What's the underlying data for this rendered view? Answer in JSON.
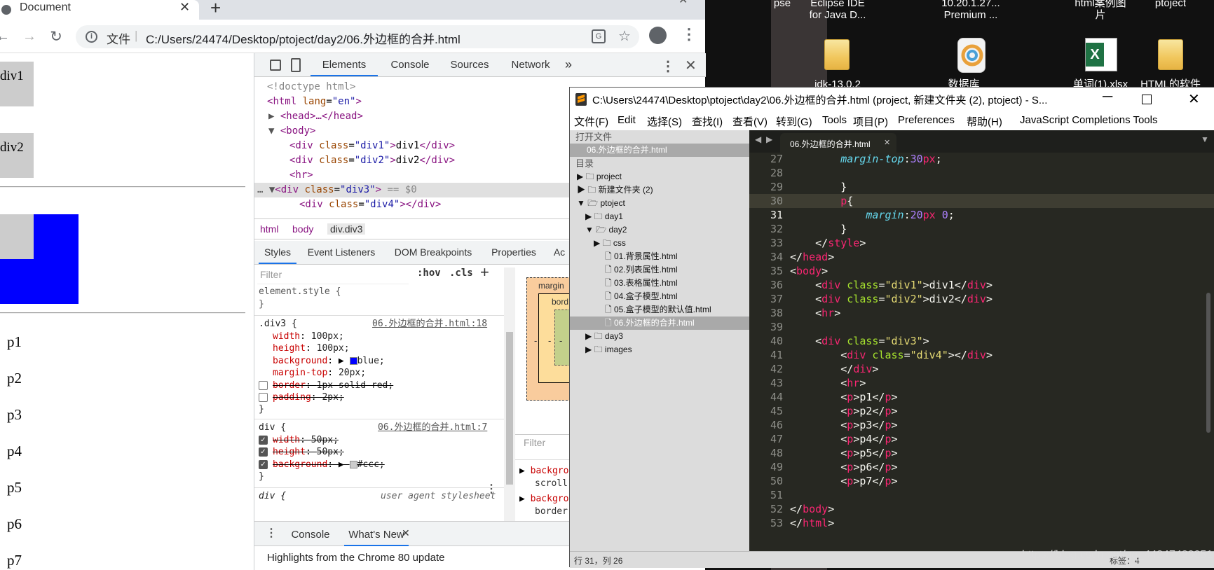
{
  "browser": {
    "tab_title": "Document",
    "file_label": "文件",
    "url": "C:/Users/24474/Desktop/ptoject/day2/06.外边框的合并.html",
    "page": {
      "div1": "div1",
      "div2": "div2",
      "paragraphs": [
        "p1",
        "p2",
        "p3",
        "p4",
        "p5",
        "p6",
        "p7"
      ]
    }
  },
  "devtools": {
    "tabs": [
      "Elements",
      "Console",
      "Sources",
      "Network"
    ],
    "dom": {
      "doctype": "<!doctype html>",
      "html_tag": "html",
      "html_attr": "lang",
      "html_val": "\"en\"",
      "head": "<head>…</head>",
      "body": "<body>",
      "div1_label": "div1",
      "div2_label": "div2",
      "div3_suffix": "== $0"
    },
    "breadcrumbs": [
      "html",
      "body",
      "div.div3"
    ],
    "style_tabs": [
      "Styles",
      "Event Listeners",
      "DOM Breakpoints",
      "Properties",
      "Ac"
    ],
    "filter_placeholder": "Filter",
    "hov": ":hov",
    "cls": ".cls",
    "element_style": "element.style {",
    "rule1": {
      "selector": ".div3 {",
      "source": "06.外边框的合并.html:18",
      "props": [
        {
          "n": "width",
          "v": "100px;"
        },
        {
          "n": "height",
          "v": "100px;"
        },
        {
          "n": "background",
          "v": "blue;"
        },
        {
          "n": "margin-top",
          "v": "20px;"
        },
        {
          "n": "border",
          "v": "1px solid red;"
        },
        {
          "n": "padding",
          "v": "2px;"
        }
      ]
    },
    "rule2": {
      "selector": "div {",
      "source": "06.外边框的合并.html:7",
      "props": [
        {
          "n": "width",
          "v": "50px;"
        },
        {
          "n": "height",
          "v": "50px;"
        },
        {
          "n": "background",
          "v": "#ccc;"
        }
      ]
    },
    "rule3": {
      "selector": "div {",
      "source": "user agent stylesheet"
    },
    "box_margin": "margin",
    "box_border": "bord",
    "box_dash": "-",
    "computed_filter": "Filter",
    "computed": [
      {
        "n": "backgro",
        "v": "scroll"
      },
      {
        "n": "backgro",
        "v": "border-"
      }
    ],
    "drawer_tabs": [
      "Console",
      "What's New"
    ],
    "drawer_text": "Highlights from the Chrome 80 update",
    "colors": {
      "blue": "#0000ff",
      "red": "#ff0000",
      "ccc": "#cccccc"
    }
  },
  "desktop": {
    "labels": [
      "pse",
      "Eclipse IDE\nfor Java D...",
      "10.20.1.27...\nPremium ...",
      "html案例图\n片",
      "ptoject"
    ],
    "bottom_labels": [
      "idk-13.0.2",
      "数据库",
      "单词(1).xlsx",
      "HTML的软件"
    ]
  },
  "sublime": {
    "title": "C:\\Users\\24474\\Desktop\\ptoject\\day2\\06.外边框的合并.html (project, 新建文件夹 (2), ptoject) - S...",
    "menu": [
      "文件(F)",
      "Edit",
      "选择(S)",
      "查找(I)",
      "查看(V)",
      "转到(G)",
      "Tools",
      "项目(P)",
      "Preferences",
      "帮助(H)",
      "JavaScript Completions Tools"
    ],
    "open_files_label": "打开文件",
    "open_file": "06.外边框的合并.html",
    "folders_label": "目录",
    "tree": [
      "project",
      "新建文件夹 (2)",
      "ptoject",
      "day1",
      "day2",
      "css",
      "01.背景属性.html",
      "02.列表属性.html",
      "03.表格属性.html",
      "04.盒子模型.html",
      "05.盒子模型的默认值.html",
      "06.外边框的合并.html",
      "day3",
      "images"
    ],
    "tab": "06.外边框的合并.html",
    "status": "行 31，列 26",
    "status_right": "标签：4",
    "watermark": "https://blog.csdn.net/qq_44247420051"
  }
}
